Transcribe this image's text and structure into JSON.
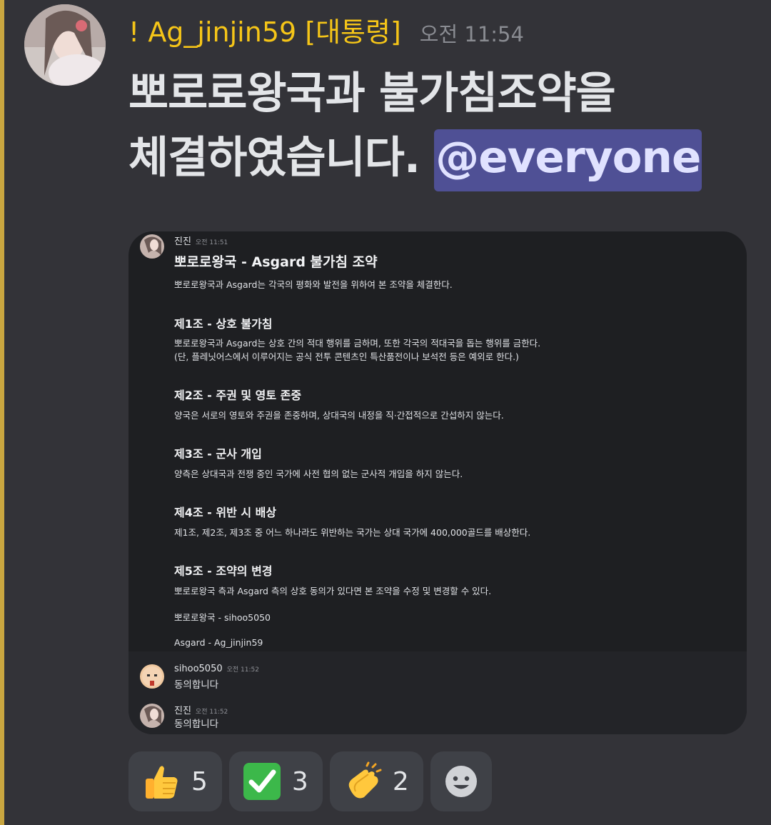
{
  "author": {
    "name": "! Ag_jinjin59 [대통령]",
    "time": "오전 11:54"
  },
  "message": {
    "line1": "뽀로로왕국과 불가침조약을",
    "line2": "체결하였습니다.",
    "mention": "@everyone"
  },
  "embed": {
    "author": "진진",
    "time": "오전 11:51",
    "title": "뽀로로왕국 - Asgard 불가침 조약",
    "intro": "뽀로로왕국과 Asgard는 각국의 평화와 발전을 위하여 본 조약을 체결한다.",
    "articles": [
      {
        "title": "제1조 - 상호 불가침",
        "lines": [
          "뽀로로왕국과 Asgard는 상호 간의 적대 행위를 금하며, 또한 각국의 적대국을 돕는 행위를 금한다.",
          "(단, 플레닛어스에서 이루어지는 공식 전투 콘텐츠인 특산품전이나 보석전 등은 예외로 한다.)"
        ]
      },
      {
        "title": "제2조 - 주권 및 영토 존중",
        "lines": [
          "양국은 서로의 영토와 주권을 존중하며, 상대국의 내정을 직·간접적으로 간섭하지 않는다."
        ]
      },
      {
        "title": "제3조 - 군사 개입",
        "lines": [
          "양측은 상대국과 전쟁 중인 국가에 사전 협의 없는 군사적 개입을 하지 않는다."
        ]
      },
      {
        "title": "제4조 - 위반 시 배상",
        "lines": [
          "제1조, 제2조, 제3조 중 어느 하나라도 위반하는 국가는 상대 국가에 400,000골드를 배상한다."
        ]
      },
      {
        "title": "제5조 - 조약의 변경",
        "lines": [
          "뽀로로왕국 측과 Asgard 측의 상호 동의가 있다면 본 조약을 수정 및 변경할 수 있다."
        ]
      }
    ],
    "sign1": "뽀로로왕국 - sihoo5050",
    "sign2": "Asgard - Ag_jinjin59"
  },
  "replies": [
    {
      "author": "sihoo5050",
      "time": "오전 11:52",
      "text": "동의합니다"
    },
    {
      "author": "진진",
      "time": "오전 11:52",
      "text": "동의합니다"
    }
  ],
  "reactions": [
    {
      "emoji": "thumbs-up-icon",
      "count": "5"
    },
    {
      "emoji": "check-mark-icon",
      "count": "3"
    },
    {
      "emoji": "clapping-hands-icon",
      "count": "2"
    }
  ],
  "colors": {
    "username": "#f5c518",
    "mention_bg": "#4f5095",
    "accent_bar": "#c9a640"
  }
}
